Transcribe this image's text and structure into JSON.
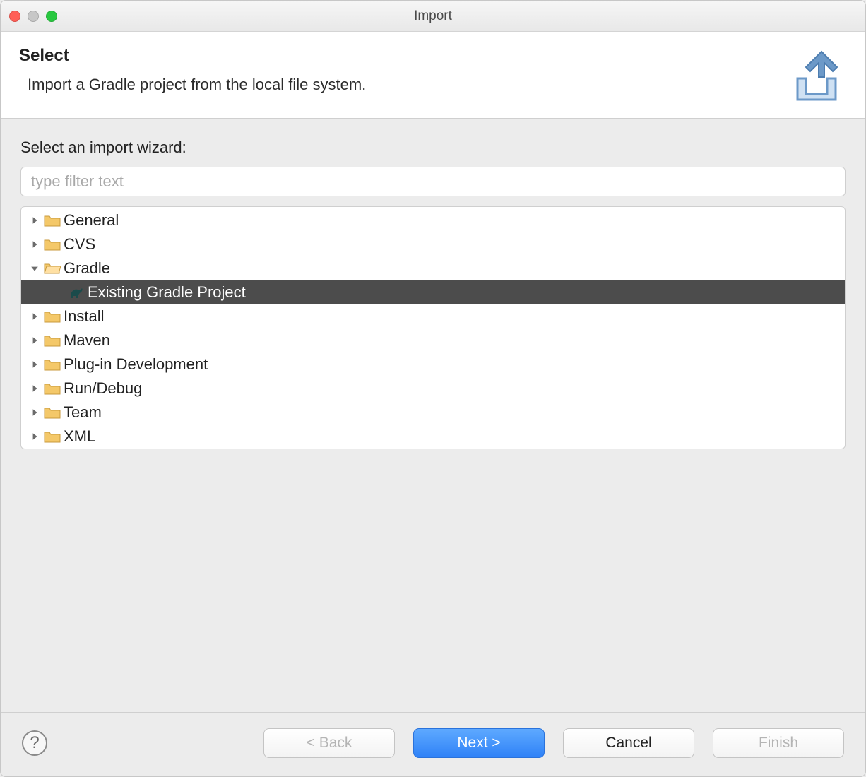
{
  "window": {
    "title": "Import"
  },
  "header": {
    "title": "Select",
    "subtitle": "Import a Gradle project from the local file system."
  },
  "body": {
    "label": "Select an import wizard:",
    "filter_placeholder": "type filter text"
  },
  "tree": [
    {
      "label": "General",
      "expanded": false,
      "children": []
    },
    {
      "label": "CVS",
      "expanded": false,
      "children": []
    },
    {
      "label": "Gradle",
      "expanded": true,
      "children": [
        {
          "label": "Existing Gradle Project",
          "icon": "gradle-elephant",
          "selected": true
        }
      ]
    },
    {
      "label": "Install",
      "expanded": false,
      "children": []
    },
    {
      "label": "Maven",
      "expanded": false,
      "children": []
    },
    {
      "label": "Plug-in Development",
      "expanded": false,
      "children": []
    },
    {
      "label": "Run/Debug",
      "expanded": false,
      "children": []
    },
    {
      "label": "Team",
      "expanded": false,
      "children": []
    },
    {
      "label": "XML",
      "expanded": false,
      "children": []
    }
  ],
  "buttons": {
    "back": {
      "label": "< Back",
      "enabled": false
    },
    "next": {
      "label": "Next >",
      "enabled": true,
      "primary": true
    },
    "cancel": {
      "label": "Cancel",
      "enabled": true
    },
    "finish": {
      "label": "Finish",
      "enabled": false
    }
  }
}
